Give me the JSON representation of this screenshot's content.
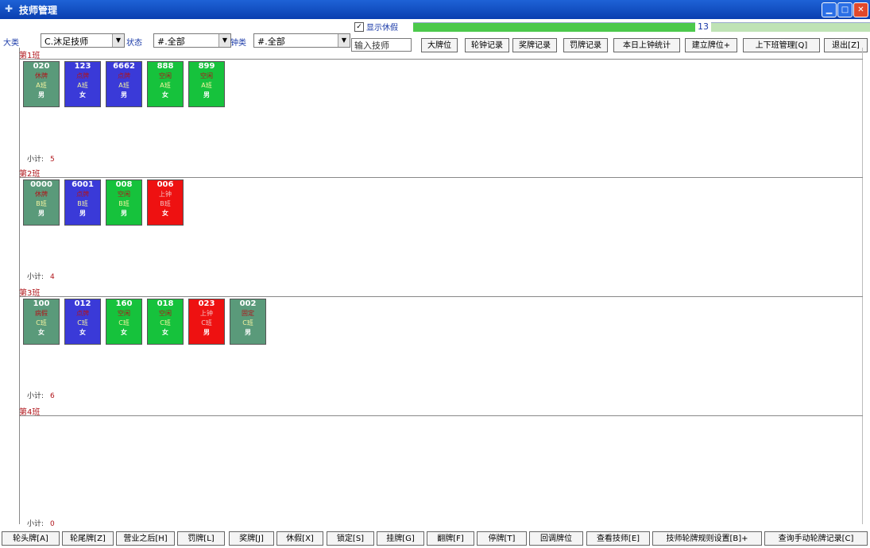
{
  "window": {
    "title": "技师管理",
    "icon": "app-icon",
    "controls": [
      "minimize",
      "maximize",
      "close"
    ]
  },
  "toolbar": {
    "category_label": "大类",
    "category_value": "C.沐足技师",
    "status_label": "状态",
    "status_value": "#.全部",
    "type_label": "钟类",
    "type_value": "#.全部",
    "show_leave_label": "显示休假",
    "show_leave_checked": true,
    "progress_value": "13",
    "tech_input_placeholder": "输入技师",
    "buttons": [
      "大牌位",
      "轮钟记录",
      "奖牌记录",
      "罚牌记录",
      "本日上钟统计",
      "建立牌位+",
      "上下班管理[Q]",
      "退出[Z]"
    ]
  },
  "shifts": [
    {
      "name": "第1班",
      "subtotal_label": "小计:",
      "count": "5",
      "cards": [
        {
          "no": "020",
          "status": "休牌",
          "shift": "A班",
          "sex": "男",
          "color": "gray"
        },
        {
          "no": "123",
          "status": "点牌",
          "shift": "A班",
          "sex": "女",
          "color": "blue"
        },
        {
          "no": "6662",
          "status": "点牌",
          "shift": "A班",
          "sex": "男",
          "color": "blue"
        },
        {
          "no": "888",
          "status": "空闲",
          "shift": "A班",
          "sex": "女",
          "color": "green"
        },
        {
          "no": "899",
          "status": "空闲",
          "shift": "A班",
          "sex": "男",
          "color": "green"
        }
      ]
    },
    {
      "name": "第2班",
      "subtotal_label": "小计:",
      "count": "4",
      "cards": [
        {
          "no": "0000",
          "status": "休牌",
          "shift": "B班",
          "sex": "男",
          "color": "gray"
        },
        {
          "no": "6001",
          "status": "点牌",
          "shift": "B班",
          "sex": "男",
          "color": "blue"
        },
        {
          "no": "008",
          "status": "空闲",
          "shift": "B班",
          "sex": "男",
          "color": "green"
        },
        {
          "no": "006",
          "status": "上钟",
          "shift": "B班",
          "sex": "女",
          "color": "red"
        }
      ]
    },
    {
      "name": "第3班",
      "subtotal_label": "小计:",
      "count": "6",
      "cards": [
        {
          "no": "100",
          "status": "病假",
          "shift": "C班",
          "sex": "女",
          "color": "gray"
        },
        {
          "no": "012",
          "status": "点牌",
          "shift": "C班",
          "sex": "女",
          "color": "blue"
        },
        {
          "no": "160",
          "status": "空闲",
          "shift": "C班",
          "sex": "女",
          "color": "green"
        },
        {
          "no": "018",
          "status": "空闲",
          "shift": "C班",
          "sex": "女",
          "color": "green"
        },
        {
          "no": "023",
          "status": "上钟",
          "shift": "C班",
          "sex": "男",
          "color": "red"
        },
        {
          "no": "002",
          "status": "固定",
          "shift": "C班",
          "sex": "男",
          "color": "gray"
        }
      ]
    },
    {
      "name": "第4班",
      "subtotal_label": "小计:",
      "count": "0",
      "cards": []
    }
  ],
  "bottom_buttons": [
    "轮头牌[A]",
    "轮尾牌[Z]",
    "营业之后[H]",
    "罚牌[L]",
    "奖牌[J]",
    "休假[X]",
    "锁定[S]",
    "挂牌[G]",
    "翻牌[F]",
    "停牌[T]",
    "回调牌位",
    "查看技师[E]",
    "技师轮牌规则设置[B]+",
    "查询手动轮牌记录[C]"
  ],
  "colors": {
    "title_bar": "#0a3fb0",
    "card_gray": "#5a9a7a",
    "card_blue": "#3a3ad8",
    "card_green": "#16c23c",
    "card_red": "#ee1111",
    "shift_label": "#b0141a"
  }
}
